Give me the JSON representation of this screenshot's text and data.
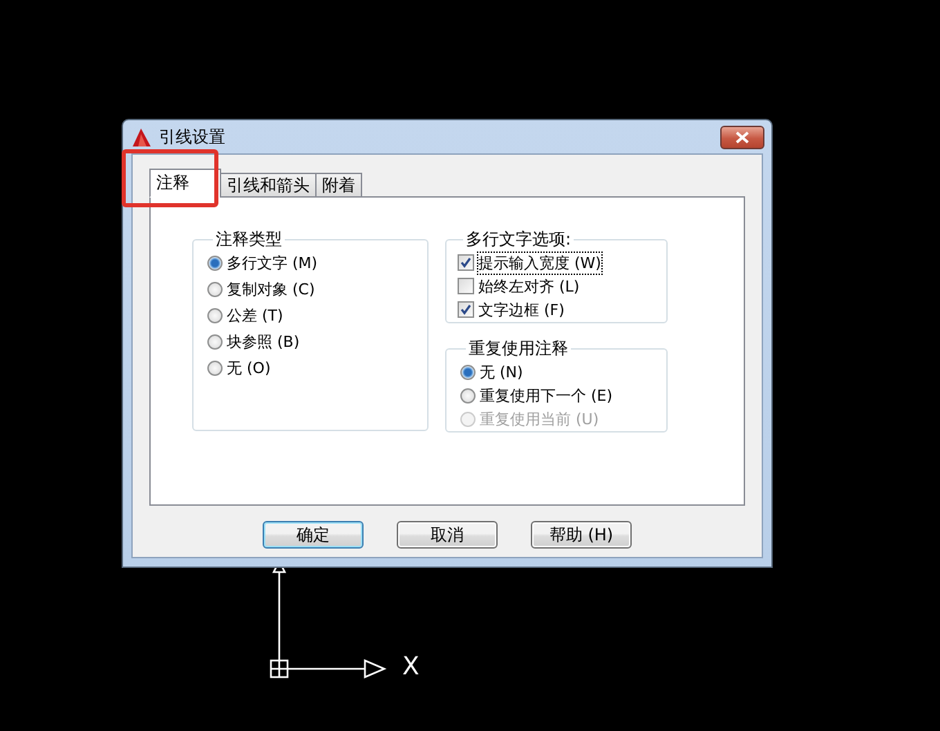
{
  "window": {
    "title": "引线设置"
  },
  "tabs": [
    {
      "label": "注释",
      "selected": true,
      "highlighted": true
    },
    {
      "label": "引线和箭头",
      "selected": false,
      "highlighted": false
    },
    {
      "label": "附着",
      "selected": false,
      "highlighted": false
    }
  ],
  "annotation_type": {
    "title": "注释类型",
    "options": [
      {
        "label": "多行文字 (M)",
        "selected": true
      },
      {
        "label": "复制对象 (C)",
        "selected": false
      },
      {
        "label": "公差 (T)",
        "selected": false
      },
      {
        "label": "块参照 (B)",
        "selected": false
      },
      {
        "label": "无 (O)",
        "selected": false
      }
    ]
  },
  "mtext_options": {
    "title": "多行文字选项:",
    "options": [
      {
        "label": "提示输入宽度 (W)",
        "checked": true,
        "focused": true
      },
      {
        "label": "始终左对齐 (L)",
        "checked": false,
        "focused": false
      },
      {
        "label": "文字边框 (F)",
        "checked": true,
        "focused": false
      }
    ]
  },
  "reuse_annotation": {
    "title": "重复使用注释",
    "options": [
      {
        "label": "无 (N)",
        "selected": true,
        "disabled": false
      },
      {
        "label": "重复使用下一个 (E)",
        "selected": false,
        "disabled": false
      },
      {
        "label": "重复使用当前 (U)",
        "selected": false,
        "disabled": true
      }
    ]
  },
  "buttons": [
    {
      "label": "确定",
      "default": true
    },
    {
      "label": "取消",
      "default": false
    },
    {
      "label": "帮助 (H)",
      "default": false
    }
  ],
  "ucs": {
    "x_label": "X"
  }
}
